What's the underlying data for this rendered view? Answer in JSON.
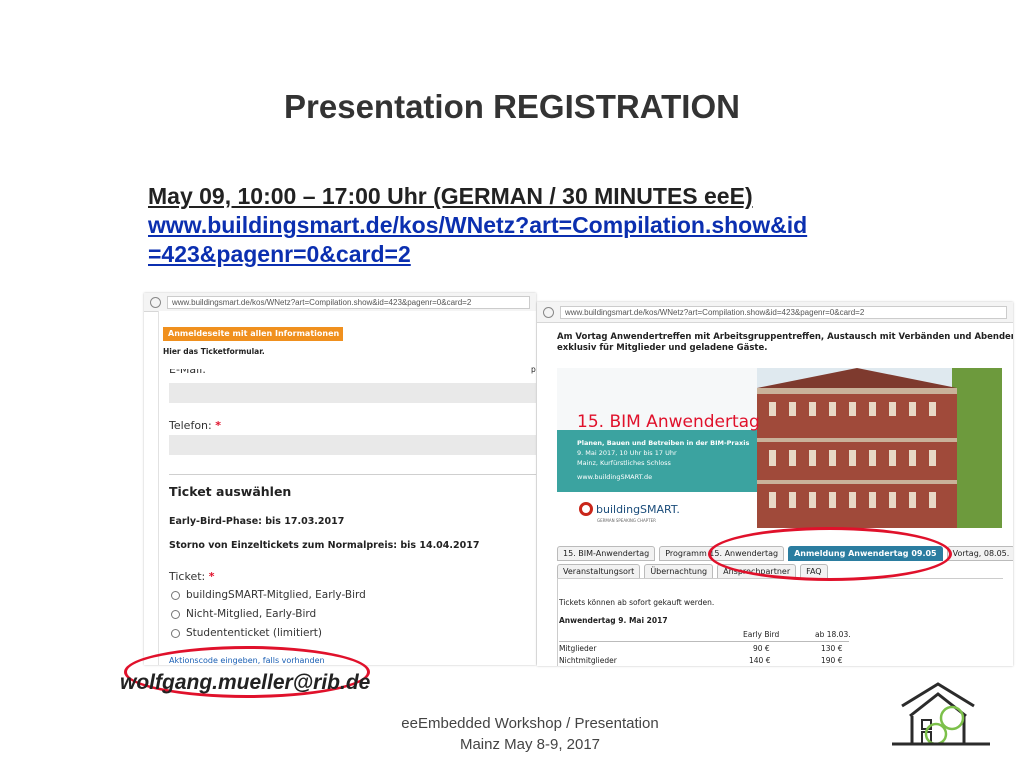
{
  "slide": {
    "title": "Presentation REGISTRATION",
    "date_line": "May 09,  10:00  – 17:00 Uhr  (GERMAN / 30 MINUTES eeE)",
    "link_line1": "www.buildingsmart.de/kos/WNetz?art=Compilation.show&id",
    "link_line2": "=423&pagenr=0&card=2",
    "email": "wolfgang.mueller@rib.de",
    "footer_line1": "eeEmbedded Workshop / Presentation",
    "footer_line2": "Mainz May 8-9, 2017"
  },
  "left_browser": {
    "url": "www.buildingsmart.de/kos/WNetz?art=Compilation.show&id=423&pagenr=0&card=2",
    "orange_button": "Anmeldeseite mit allen Informationen »",
    "ticket_form_text": "Hier das Ticketformular.",
    "email_label": "E-Mail:",
    "side_text": "pov",
    "phone_label": "Telefon:",
    "required_mark": "*",
    "ticket_heading": "Ticket auswählen",
    "early_bird": "Early-Bird-Phase: bis 17.03.2017",
    "storno": "Storno von Einzeltickets zum Normalpreis: bis 14.04.2017",
    "ticket_label": "Ticket:",
    "options": [
      "buildingSMART-Mitglied, Early-Bird",
      "Nicht-Mitglied, Early-Bird",
      "Studententicket (limitiert)"
    ],
    "option_side_value": "1",
    "promo_link": "Aktionscode eingeben, falls vorhanden"
  },
  "right_browser": {
    "url": "www.buildingsmart.de/kos/WNetz?art=Compilation.show&id=423&pagenr=0&card=2",
    "intro_line1": "Am Vortag Anwendertreffen mit Arbeitsgruppentreffen, Austausch mit Verbänden und Abendempfang -",
    "intro_line2": "exklusiv für Mitglieder und geladene Gäste.",
    "banner": {
      "title": "15. BIM Anwendertag",
      "line1": "Planen, Bauen und Betreiben in der BIM-Praxis",
      "line2": "9. Mai 2017, 10 Uhr bis 17 Uhr",
      "line3": "Mainz, Kurfürstliches Schloss",
      "line4": "www.buildingSMART.de",
      "logo": "buildingSMART.",
      "logo_sub": "GERMAN SPEAKING CHAPTER"
    },
    "tabs_row1": [
      "15. BIM-Anwendertag",
      "Programm 15. Anwendertag",
      "Anmeldung Anwendertag 09.05",
      "Vortag, 08.05."
    ],
    "tabs_row2": [
      "Veranstaltungsort",
      "Übernachtung",
      "Ansprechpartner",
      "FAQ"
    ],
    "tickets_text": "Tickets können ab sofort gekauft werden.",
    "table_title": "Anwendertag 9. Mai 2017",
    "columns": [
      "Early Bird",
      "ab 18.03."
    ],
    "rows": [
      {
        "label": "Mitglieder",
        "early": "90 €",
        "late": "130 €"
      },
      {
        "label": "Nichtmitglieder",
        "early": "140 €",
        "late": "190 €"
      }
    ]
  },
  "colors": {
    "accent_red": "#e0112b",
    "link_blue": "#0b2fb0",
    "orange": "#f0901e",
    "teal": "#2b7da0",
    "banner_green": "#3ba3a0"
  }
}
